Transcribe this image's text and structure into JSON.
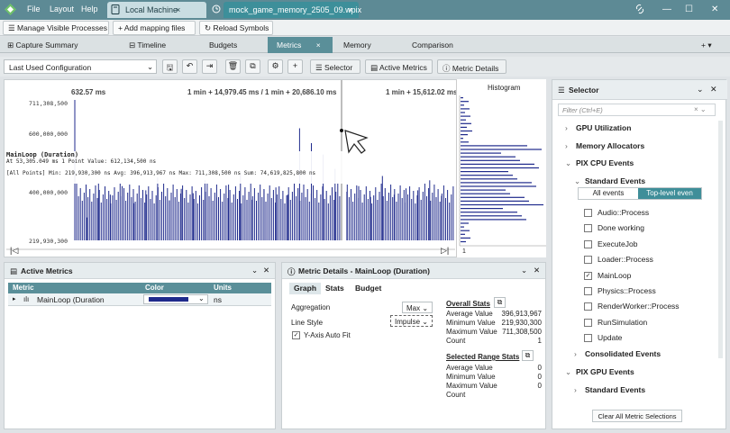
{
  "titlebar": {
    "menus": [
      "File",
      "Layout",
      "Help"
    ],
    "tabs": [
      {
        "label": "Local Machine",
        "close": "×"
      },
      {
        "label": "mock_game_memory_2505_09.wpix",
        "close": "×"
      }
    ],
    "window_controls": {
      "minimize": "—",
      "maximize": "☐",
      "close": "✕"
    }
  },
  "toolbar": {
    "manage_label": "Manage Visible Processes",
    "add_mapping_label": "Add mapping files",
    "reload_symbols_label": "Reload Symbols"
  },
  "view_tabs": [
    {
      "label": "Capture Summary",
      "active": false
    },
    {
      "label": "Timeline",
      "active": false
    },
    {
      "label": "Budgets",
      "active": false
    },
    {
      "label": "Metrics",
      "active": true
    },
    {
      "label": "Memory",
      "active": false
    },
    {
      "label": "Comparison",
      "active": false
    }
  ],
  "view_tabs_right": "+ ▾",
  "config": {
    "selected": "Last Used Configuration",
    "selector_label": "Selector",
    "active_metrics_label": "Active Metrics",
    "metric_details_label": "Metric Details"
  },
  "graph": {
    "time_labels": [
      "632.57 ms",
      "1 min + 14,979.45 ms / 1 min + 20,686.10 ms",
      "1 min + 15,612.02 ms"
    ],
    "y_labels": [
      "711,308,500",
      "600,000,000",
      "400,000,000",
      "219,930,300"
    ],
    "tooltip": {
      "title": "MainLoop (Duration)",
      "line1": "At 53,305.049 ms  1 Point  Value: 612,134,500 ns",
      "line2": "[All Points]  Min: 219,930,300 ns  Avg: 396,913,967 ns  Max: 711,308,500 ns  Sum: 74,619,825,800 ns"
    },
    "nav_left": "|◁",
    "nav_right": "▷|"
  },
  "chart_data": {
    "type": "bar",
    "title": "",
    "ylabel": "",
    "series": [
      {
        "name": "MainLoop (Duration)",
        "unit": "ns"
      }
    ],
    "min": 219930300,
    "avg": 396913967,
    "max": 711308500,
    "sum": 74619825800,
    "points_selected": 1,
    "cursor_value": 612134500,
    "cursor_time_ms": 53305.049,
    "ylim": [
      219930300,
      711308500
    ],
    "values": [
      711308500,
      300000000,
      420000000,
      380000000,
      410000000,
      350000000,
      395000000,
      440000000,
      360000000,
      400000000,
      385000000,
      430000000,
      370000000,
      415000000,
      450000000,
      362000000,
      398000000,
      405000000,
      380000000,
      612134500,
      560000000,
      520000000,
      470000000,
      390000000,
      410000000,
      372000000,
      445000000,
      380000000,
      402000000,
      395000000,
      430000000,
      376000000
    ]
  },
  "histogram": {
    "title": "Histogram",
    "axis_label": "1"
  },
  "selector": {
    "title": "Selector",
    "filter_placeholder": "Filter (Ctrl+E)",
    "items": [
      {
        "label": "GPU Utilization",
        "level": 0,
        "expand": "›"
      },
      {
        "label": "Memory Allocators",
        "level": 0,
        "expand": "›"
      },
      {
        "label": "PIX CPU Events",
        "level": 0,
        "expand": "⌄"
      },
      {
        "label": "Standard Events",
        "level": 1,
        "expand": "⌄"
      }
    ],
    "toggle": {
      "all_events": "All events",
      "top_level": "Top-level even"
    },
    "events": [
      {
        "label": "Audio::Process",
        "checked": false
      },
      {
        "label": "Done working",
        "checked": false
      },
      {
        "label": "ExecuteJob",
        "checked": false
      },
      {
        "label": "Loader::Process",
        "checked": false
      },
      {
        "label": "MainLoop",
        "checked": true
      },
      {
        "label": "Physics::Process",
        "checked": false
      },
      {
        "label": "RenderWorker::Process",
        "checked": false
      },
      {
        "label": "RunSimulation",
        "checked": false
      },
      {
        "label": "Update",
        "checked": false
      }
    ],
    "after": [
      {
        "label": "Consolidated Events",
        "level": 1,
        "expand": "›"
      },
      {
        "label": "PIX GPU Events",
        "level": 0,
        "expand": "⌄"
      },
      {
        "label": "Standard Events",
        "level": 1,
        "expand": "›"
      }
    ],
    "clear_label": "Clear All Metric Selections"
  },
  "active_metrics": {
    "title": "Active Metrics",
    "columns": [
      "Metric",
      "Color",
      "Units"
    ],
    "row": {
      "metric": "MainLoop (Duration",
      "color": "#1f2a8c",
      "units": "ns"
    }
  },
  "metric_details": {
    "title": "Metric Details - MainLoop (Duration)",
    "tabs": [
      "Graph",
      "Stats",
      "Budget"
    ],
    "aggregation_label": "Aggregation",
    "aggregation_value": "Max",
    "line_style_label": "Line Style",
    "line_style_value": "Impulse",
    "yaxis_fit_label": "Y-Axis Auto Fit",
    "overall_title": "Overall Stats",
    "overall": [
      {
        "label": "Average Value",
        "value": "396,913,967"
      },
      {
        "label": "Minimum Value",
        "value": "219,930,300"
      },
      {
        "label": "Maximum Value",
        "value": "711,308,500"
      },
      {
        "label": "Count",
        "value": "1"
      }
    ],
    "range_title": "Selected Range Stats",
    "range": [
      {
        "label": "Average Value",
        "value": "0"
      },
      {
        "label": "Minimum Value",
        "value": "0"
      },
      {
        "label": "Maximum Value",
        "value": "0"
      },
      {
        "label": "Count",
        "value": ""
      }
    ]
  }
}
